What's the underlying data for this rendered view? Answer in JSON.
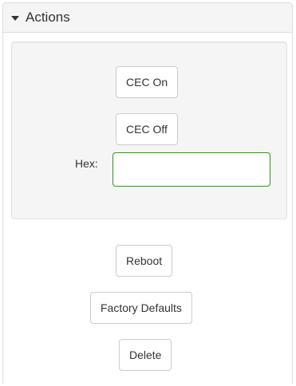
{
  "panel": {
    "title": "Actions",
    "toggle_icon": "caret-down-icon"
  },
  "cec": {
    "on_label": "CEC On",
    "off_label": "CEC Off",
    "hex_label": "Hex:",
    "hex_value": "",
    "hex_placeholder": ""
  },
  "actions": {
    "reboot_label": "Reboot",
    "factory_defaults_label": "Factory Defaults",
    "delete_label": "Delete"
  },
  "colors": {
    "input_border_focus": "#3c8a2e",
    "well_background": "#f5f5f5",
    "heading_background": "#f5f5f5"
  }
}
